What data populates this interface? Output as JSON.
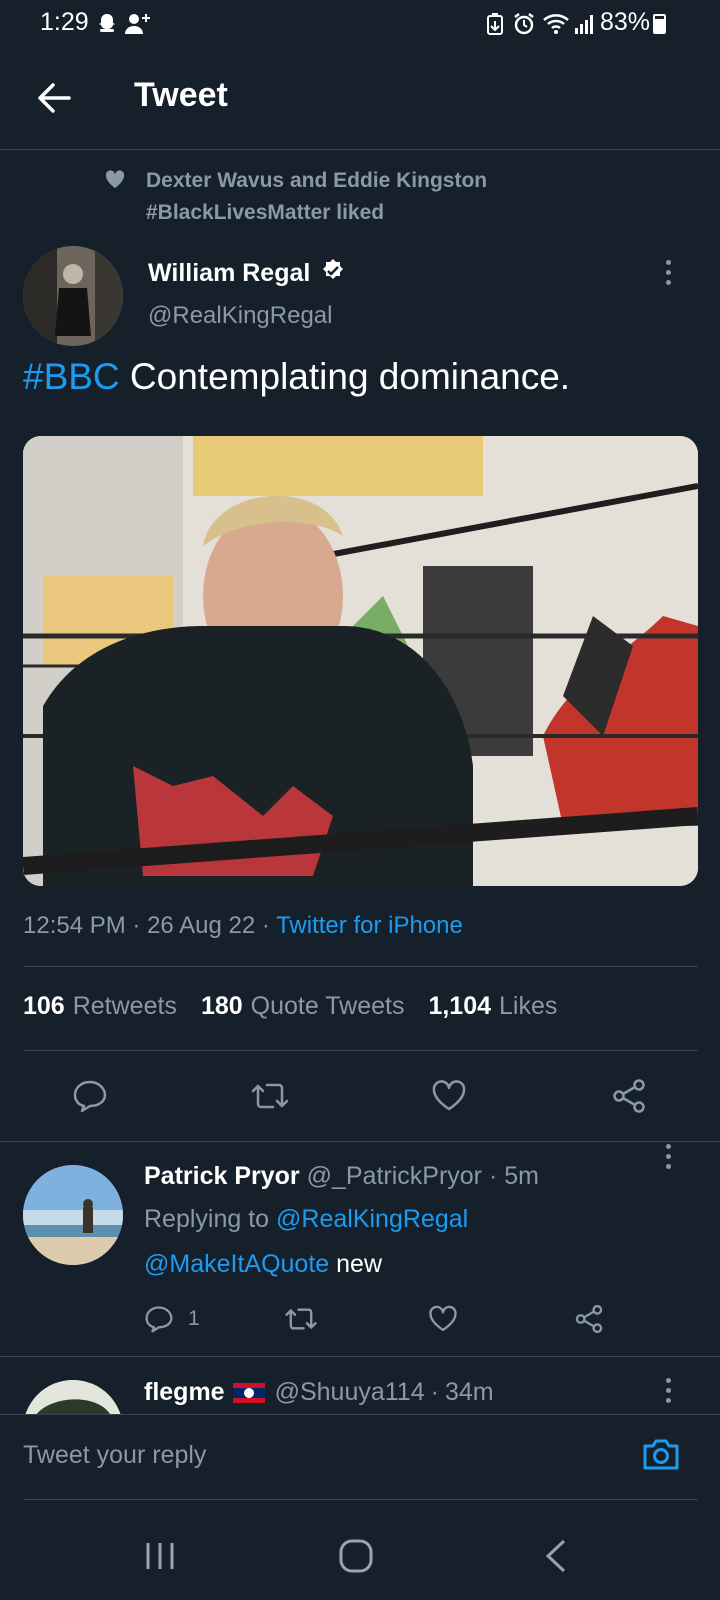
{
  "status_bar": {
    "time": "1:29",
    "battery": "83%"
  },
  "header": {
    "title": "Tweet"
  },
  "social_context": {
    "line1": "Dexter Wavus and Eddie Kingston",
    "line2": "#BlackLivesMatter liked"
  },
  "tweet": {
    "author_name": "William Regal",
    "author_handle": "@RealKingRegal",
    "hashtag": "#BBC",
    "text": " Contemplating dominance.",
    "time": "12:54 PM",
    "date": "26 Aug 22",
    "source": "Twitter for iPhone",
    "sep": "·",
    "stats": {
      "retweets_count": "106",
      "retweets_label": "Retweets",
      "quotes_count": "180",
      "quotes_label": "Quote Tweets",
      "likes_count": "1,104",
      "likes_label": "Likes"
    }
  },
  "reply": {
    "name": "Patrick Pryor",
    "handle": "@_PatrickPryor",
    "age": "5m",
    "replying_prefix": "Replying to ",
    "replying_handle": "@RealKingRegal",
    "mention": "@MakeItAQuote",
    "text": " new",
    "reply_count": "1"
  },
  "next_reply": {
    "name": "flegme",
    "handle": "@Shuuya114",
    "age": "34m"
  },
  "composer": {
    "placeholder": "Tweet your reply"
  },
  "colors": {
    "background": "#15202b",
    "accent": "#1d9bf0",
    "muted": "#8b98a5",
    "divider": "#38444d"
  }
}
